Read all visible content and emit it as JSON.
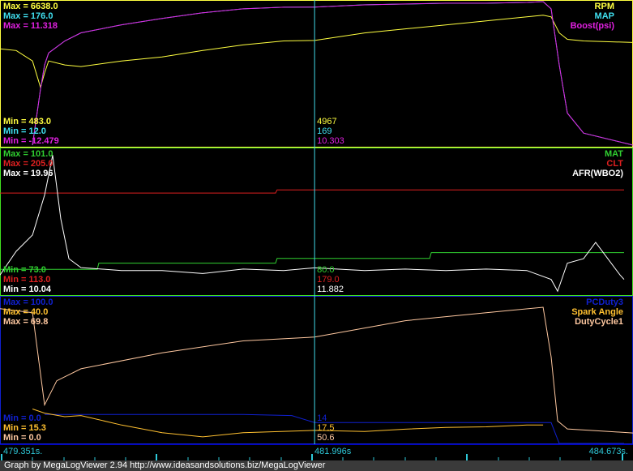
{
  "chart_data": [
    {
      "type": "line",
      "panel": "top",
      "x_range": [
        479.351,
        484.673
      ],
      "series": [
        {
          "name": "RPM",
          "color": "#ffff40",
          "max_label": "Max = 6638.0",
          "min_label": "Min = 483.0",
          "cursor_value": "4967",
          "min": 483.0,
          "max": 6638.0,
          "points": [
            [
              479.351,
              4609
            ],
            [
              479.487,
              4541
            ],
            [
              479.624,
              4102
            ],
            [
              479.692,
              2986
            ],
            [
              479.726,
              3594
            ],
            [
              479.76,
              4102
            ],
            [
              479.896,
              3932
            ],
            [
              480.032,
              3865
            ],
            [
              480.373,
              4102
            ],
            [
              480.714,
              4271
            ],
            [
              481.055,
              4541
            ],
            [
              481.395,
              4778
            ],
            [
              481.736,
              4947
            ],
            [
              481.996,
              4967
            ],
            [
              482.417,
              5285
            ],
            [
              482.758,
              5455
            ],
            [
              483.099,
              5624
            ],
            [
              483.439,
              5793
            ],
            [
              483.78,
              5962
            ],
            [
              483.917,
              6029
            ],
            [
              483.985,
              5962
            ],
            [
              484.053,
              5285
            ],
            [
              484.121,
              5015
            ],
            [
              484.257,
              4947
            ],
            [
              484.673,
              4880
            ]
          ]
        },
        {
          "name": "MAP",
          "color": "#40e0f0",
          "max_label": "Max = 176.0",
          "min_label": "Min = 12.0",
          "cursor_value": "169",
          "min": 12.0,
          "max": 176.0,
          "points": [
            [
              479.624,
              13.8
            ],
            [
              479.692,
              76.9
            ],
            [
              479.726,
              103.9
            ],
            [
              479.76,
              117.4
            ],
            [
              479.896,
              130.9
            ],
            [
              480.032,
              140
            ],
            [
              480.373,
              149
            ],
            [
              480.714,
              156.2
            ],
            [
              481.055,
              162.5
            ],
            [
              481.395,
              167
            ],
            [
              481.736,
              168.8
            ],
            [
              481.996,
              169
            ],
            [
              482.417,
              171.5
            ],
            [
              482.758,
              172.4
            ],
            [
              483.099,
              173.3
            ],
            [
              483.439,
              173.3
            ],
            [
              483.78,
              174.2
            ],
            [
              483.917,
              175.1
            ],
            [
              483.985,
              167
            ],
            [
              484.053,
              103.9
            ],
            [
              484.121,
              49.8
            ],
            [
              484.257,
              27.3
            ],
            [
              484.673,
              13.8
            ]
          ]
        },
        {
          "name": "Boost(psi)",
          "color": "#e020e0",
          "max_label": "Max = 11.318",
          "min_label": "Min = -12.479",
          "cursor_value": "10.303",
          "min": -12.479,
          "max": 11.318,
          "points": [
            [
              479.624,
              -12.22
            ],
            [
              479.692,
              -3.06
            ],
            [
              479.726,
              0.86
            ],
            [
              479.76,
              2.82
            ],
            [
              479.896,
              4.78
            ],
            [
              480.032,
              6.09
            ],
            [
              480.373,
              7.4
            ],
            [
              480.714,
              8.44
            ],
            [
              481.055,
              9.36
            ],
            [
              481.395,
              10.01
            ],
            [
              481.736,
              10.27
            ],
            [
              481.996,
              10.303
            ],
            [
              482.417,
              10.66
            ],
            [
              482.758,
              10.8
            ],
            [
              483.099,
              10.93
            ],
            [
              483.439,
              10.93
            ],
            [
              483.78,
              11.06
            ],
            [
              483.917,
              11.19
            ],
            [
              483.985,
              10.01
            ],
            [
              484.053,
              0.86
            ],
            [
              484.121,
              -6.99
            ],
            [
              484.257,
              -10.26
            ],
            [
              484.673,
              -12.22
            ]
          ]
        }
      ]
    },
    {
      "type": "line",
      "panel": "middle",
      "x_range": [
        479.351,
        484.673
      ],
      "series": [
        {
          "name": "MAT",
          "color": "#30d030",
          "max_label": "Max = 101.0",
          "min_label": "Min = 73.0",
          "cursor_value": "80.0",
          "min": 73.0,
          "max": 101.0,
          "points": [
            [
              479.351,
              77.9
            ],
            [
              480.169,
              77.9
            ],
            [
              480.182,
              79.1
            ],
            [
              481.668,
              79.1
            ],
            [
              481.681,
              80
            ],
            [
              482.963,
              80
            ],
            [
              482.977,
              81.1
            ],
            [
              484.598,
              81.1
            ]
          ]
        },
        {
          "name": "CLT",
          "color": "#e02020",
          "max_label": "Max = 205.0",
          "min_label": "Min = 113.0",
          "cursor_value": "179.0",
          "min": 113.0,
          "max": 205.0,
          "points": [
            [
              479.351,
              177
            ],
            [
              481.668,
              177
            ],
            [
              481.681,
              179
            ],
            [
              484.598,
              179
            ]
          ]
        },
        {
          "name": "AFR(WBO2)",
          "color": "#ffffff",
          "max_label": "Max = 19.96",
          "min_label": "Min = 10.04",
          "cursor_value": "11.882",
          "min": 10.04,
          "max": 19.96,
          "points": [
            [
              479.351,
              11.4
            ],
            [
              479.487,
              13.0
            ],
            [
              479.624,
              14.1
            ],
            [
              479.726,
              16.8
            ],
            [
              479.794,
              19.5
            ],
            [
              479.862,
              15.2
            ],
            [
              479.93,
              12.5
            ],
            [
              480.032,
              11.9
            ],
            [
              480.373,
              11.7
            ],
            [
              480.714,
              11.7
            ],
            [
              481.055,
              11.5
            ],
            [
              481.395,
              11.8
            ],
            [
              481.736,
              11.7
            ],
            [
              481.996,
              11.882
            ],
            [
              482.417,
              11.7
            ],
            [
              482.758,
              11.8
            ],
            [
              483.099,
              11.7
            ],
            [
              483.439,
              11.8
            ],
            [
              483.78,
              11.7
            ],
            [
              483.985,
              11.1
            ],
            [
              484.039,
              10.3
            ],
            [
              484.121,
              12.2
            ],
            [
              484.257,
              12.5
            ],
            [
              484.359,
              13.6
            ],
            [
              484.461,
              12.5
            ],
            [
              484.564,
              11.4
            ],
            [
              484.598,
              11.1
            ]
          ]
        }
      ]
    },
    {
      "type": "line",
      "panel": "bottom",
      "x_range": [
        479.351,
        484.673
      ],
      "series": [
        {
          "name": "PCDuty3",
          "color": "#1020d0",
          "max_label": "Max = 100.0",
          "min_label": "Min = 0.0",
          "cursor_value": "14",
          "min": 0.0,
          "max": 100.0,
          "points": [
            [
              479.726,
              19.7
            ],
            [
              481.395,
              19.7
            ],
            [
              481.804,
              19
            ],
            [
              481.996,
              14.2
            ],
            [
              483.985,
              14.2
            ],
            [
              484.053,
              0
            ],
            [
              484.598,
              0
            ]
          ]
        },
        {
          "name": "Spark Angle",
          "color": "#ffc030",
          "max_label": "Max = 40.0",
          "min_label": "Min = 15.3",
          "cursor_value": "17.5",
          "min": 15.3,
          "max": 40.0,
          "points": [
            [
              479.624,
              21.1
            ],
            [
              479.726,
              20.4
            ],
            [
              479.896,
              19.8
            ],
            [
              480.032,
              20.0
            ],
            [
              480.373,
              18.4
            ],
            [
              480.714,
              17.1
            ],
            [
              481.055,
              16.4
            ],
            [
              481.395,
              17.1
            ],
            [
              481.996,
              17.5
            ],
            [
              482.417,
              17.3
            ],
            [
              482.758,
              17.7
            ],
            [
              483.099,
              18.0
            ],
            [
              483.439,
              18.1
            ],
            [
              483.78,
              18.4
            ],
            [
              483.917,
              18.4
            ]
          ]
        },
        {
          "name": "DutyCycle1",
          "color": "#ffc8a0",
          "max_label": "Max = 69.8",
          "min_label": "Min = 0.0",
          "cursor_value": "50.6",
          "min": 0.0,
          "max": 69.8,
          "points": [
            [
              479.351,
              64.1
            ],
            [
              479.624,
              62.2
            ],
            [
              479.726,
              18.3
            ],
            [
              479.828,
              29.8
            ],
            [
              480.032,
              35.5
            ],
            [
              480.714,
              43.1
            ],
            [
              481.395,
              48.8
            ],
            [
              481.996,
              50.6
            ],
            [
              482.758,
              58.4
            ],
            [
              483.439,
              62.2
            ],
            [
              483.917,
              64.8
            ],
            [
              483.985,
              41.2
            ],
            [
              484.039,
              10.7
            ],
            [
              484.121,
              6.9
            ],
            [
              484.673,
              4.96
            ]
          ]
        }
      ]
    }
  ],
  "cursor_time": 481.996,
  "time_axis": {
    "start_label": "479.351s.",
    "cursor_label": "481.996s",
    "end_label": "484.673s."
  },
  "footer": "Graph by MegaLogViewer 2.94 http://www.ideasandsolutions.biz/MegaLogViewer"
}
